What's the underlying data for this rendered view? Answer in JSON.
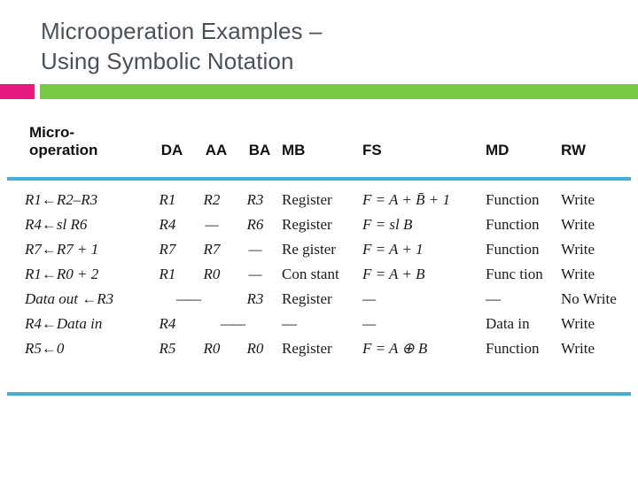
{
  "slide": {
    "title": "Microoperation Examples –\nUsing Symbolic Notation",
    "colors": {
      "title_text": "#4a5159",
      "accent_pink": "#e5197f",
      "accent_green": "#7ac943",
      "rule_teal": "#45b0ce",
      "background": "#ffffff"
    }
  },
  "table": {
    "headers": {
      "microoperation": "Micro-\noperation",
      "da": "DA",
      "aa": "AA",
      "ba": "BA",
      "mb": "MB",
      "fs": "FS",
      "md": "MD",
      "rw": "RW"
    },
    "rows": [
      {
        "microoperation": "R1←R2–R3",
        "da": "R1",
        "aa": "R2",
        "ba": "R3",
        "mb": "Register",
        "fs": "F = A + B̄ + 1",
        "md": "Function",
        "rw": "Write"
      },
      {
        "microoperation": "R4←sl R6",
        "da": "R4",
        "aa": "—",
        "ba": "R6",
        "mb": "Register",
        "fs": "F = sl B",
        "md": "Function",
        "rw": "Write"
      },
      {
        "microoperation": "R7←R7 + 1",
        "da": "R7",
        "aa": "R7",
        "ba": "—",
        "mb": "Re gister",
        "fs": "F = A + 1",
        "md": "Function",
        "rw": "Write"
      },
      {
        "microoperation": "R1←R0 + 2",
        "da": "R1",
        "aa": "R0",
        "ba": "—",
        "mb": "Con stant",
        "fs": "F = A + B",
        "md": "Func tion",
        "rw": "Write"
      },
      {
        "microoperation": "Data out ←R3",
        "da": "——",
        "aa": "",
        "ba": "R3",
        "mb": "Register",
        "fs": "—",
        "md": "—",
        "rw": "No Write"
      },
      {
        "microoperation": "R4←Data in",
        "da": "R4",
        "aa": "——",
        "ba": "",
        "mb": "—",
        "fs": "—",
        "md": "Data in",
        "rw": "Write"
      },
      {
        "microoperation": "R5←0",
        "da": "R5",
        "aa": "R0",
        "ba": "R0",
        "mb": "Register",
        "fs": "F = A ⊕ B",
        "md": "Function",
        "rw": "Write"
      }
    ]
  }
}
